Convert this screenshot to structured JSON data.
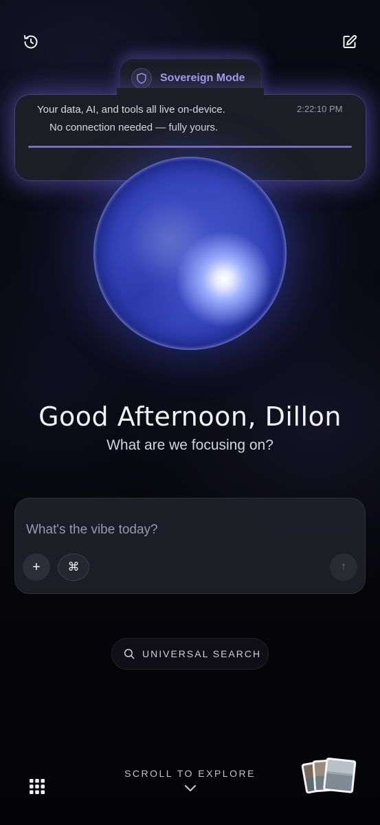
{
  "sovereign": {
    "title": "Sovereign Mode",
    "line1": "Your data, AI, and tools all live on-device.",
    "line2": "No connection needed — fully yours.",
    "time": "2:22:10 PM",
    "progress": 1.0
  },
  "greeting": "Good Afternoon, Dillon",
  "subtitle": "What are we focusing on?",
  "composer": {
    "placeholder": "What's the vibe today?",
    "plus_label": "+",
    "command_label": "⌘",
    "send_label": "↑"
  },
  "search": {
    "label": "UNIVERSAL SEARCH"
  },
  "footer": {
    "scroll_label": "SCROLL TO EXPLORE"
  },
  "icons": {
    "history": "history-icon",
    "compose": "compose-icon",
    "shield": "shield-icon",
    "search": "search-icon",
    "grid": "grid-icon",
    "chevron": "chevron-down-icon",
    "photos": "photo-stack-icon"
  },
  "colors": {
    "accent": "#a89af0",
    "glow": "#7864dc",
    "orb": "#3343b8",
    "background": "#05050a"
  }
}
